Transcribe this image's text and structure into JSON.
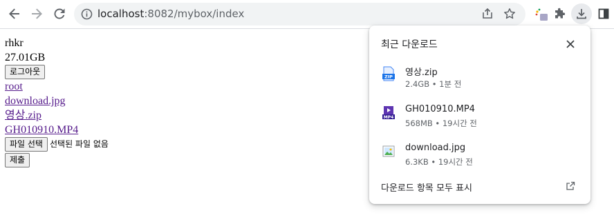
{
  "browser": {
    "url_host": "localhost",
    "url_rest": ":8082/mybox/index"
  },
  "page": {
    "username": "rhkr",
    "storage": "27.01GB",
    "logout_label": "로그아웃",
    "links": [
      "root",
      "download.jpg",
      "영상.zip",
      "GH010910.MP4"
    ],
    "file_choose_label": "파일 선택",
    "file_status": "선택된 파일 없음",
    "submit_label": "제출"
  },
  "downloads": {
    "title": "최근 다운로드",
    "items": [
      {
        "name": "영상.zip",
        "meta": "2.4GB • 1분 전",
        "icon": "zip-file-icon",
        "icon_label": "ZIP"
      },
      {
        "name": "GH010910.MP4",
        "meta": "568MB • 19시간 전",
        "icon": "mp4-file-icon",
        "icon_label": "MP4"
      },
      {
        "name": "download.jpg",
        "meta": "6.3KB • 19시간 전",
        "icon": "image-file-icon"
      }
    ],
    "footer_label": "다운로드 항목 모두 표시"
  },
  "colors": {
    "link_visited": "#551a8b",
    "omnibox_bg": "#f1f3f4",
    "icon_gray": "#5f6368"
  }
}
